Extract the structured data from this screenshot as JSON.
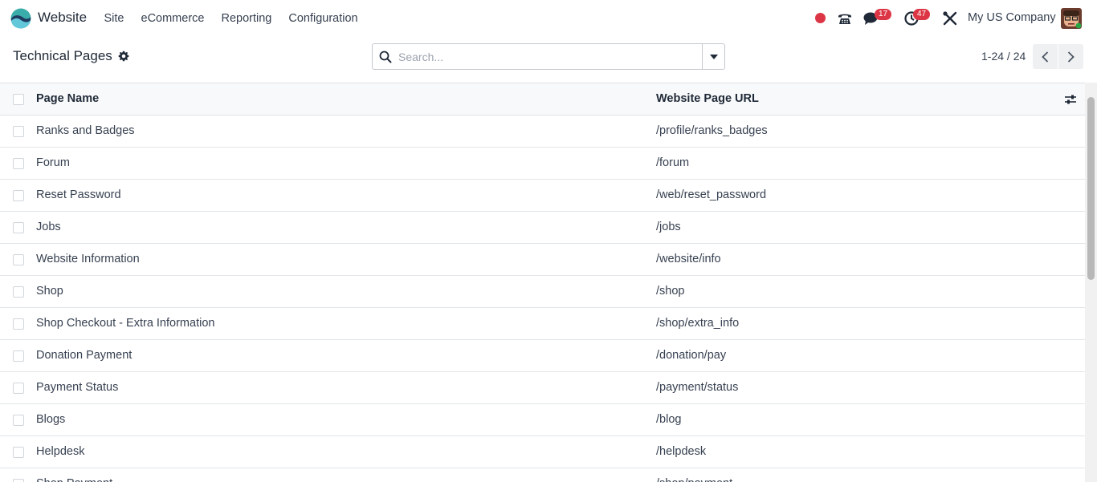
{
  "navbar": {
    "app_name": "Website",
    "menu": [
      "Site",
      "eCommerce",
      "Reporting",
      "Configuration"
    ],
    "messages_count": "17",
    "activities_count": "47",
    "company": "My US Company"
  },
  "control_panel": {
    "title": "Technical Pages",
    "search_placeholder": "Search...",
    "pager": "1-24 / 24"
  },
  "table": {
    "columns": {
      "name": "Page Name",
      "url": "Website Page URL"
    },
    "rows": [
      {
        "name": "Ranks and Badges",
        "url": "/profile/ranks_badges"
      },
      {
        "name": "Forum",
        "url": "/forum"
      },
      {
        "name": "Reset Password",
        "url": "/web/reset_password"
      },
      {
        "name": "Jobs",
        "url": "/jobs"
      },
      {
        "name": "Website Information",
        "url": "/website/info"
      },
      {
        "name": "Shop",
        "url": "/shop"
      },
      {
        "name": "Shop Checkout - Extra Information",
        "url": "/shop/extra_info"
      },
      {
        "name": "Donation Payment",
        "url": "/donation/pay"
      },
      {
        "name": "Payment Status",
        "url": "/payment/status"
      },
      {
        "name": "Blogs",
        "url": "/blog"
      },
      {
        "name": "Helpdesk",
        "url": "/helpdesk"
      },
      {
        "name": "Shop Payment",
        "url": "/shop/payment"
      }
    ]
  },
  "colors": {
    "badge": "#dc3545",
    "recording": "#dc3545",
    "header_bg": "#f8f9fa"
  }
}
